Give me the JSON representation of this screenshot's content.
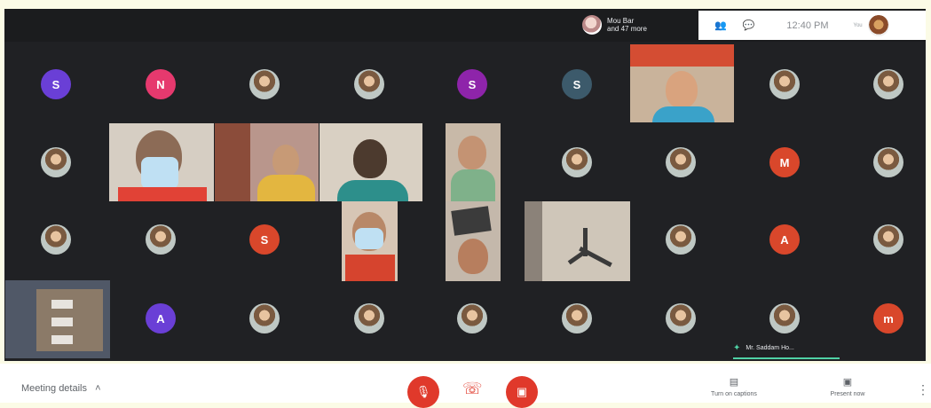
{
  "header": {
    "presenter_text": "Mou Bar\nand 47 more",
    "time": "12:40 PM",
    "self_label": "You",
    "icons": [
      "participants-icon",
      "chat-icon"
    ]
  },
  "participants": [
    {
      "type": "letter",
      "letter": "S",
      "color": "#6a3fd6"
    },
    {
      "type": "letter",
      "letter": "N",
      "color": "#e6396e"
    },
    {
      "type": "photo"
    },
    {
      "type": "photo"
    },
    {
      "type": "letter",
      "letter": "S",
      "color": "#8e24aa"
    },
    {
      "type": "letter",
      "letter": "S",
      "color": "#3c5a6b"
    },
    {
      "type": "photo"
    },
    {
      "type": "photo"
    },
    {
      "type": "photo"
    },
    {
      "type": "photo"
    },
    {
      "type": "photo"
    },
    {
      "type": "letter",
      "letter": "M",
      "color": "#d9472b"
    },
    {
      "type": "photo"
    },
    {
      "type": "photo"
    },
    {
      "type": "photo"
    },
    {
      "type": "letter",
      "letter": "S",
      "color": "#d9472b"
    },
    {
      "type": "photo"
    },
    {
      "type": "letter",
      "letter": "A",
      "color": "#d9472b"
    },
    {
      "type": "photo"
    },
    {
      "type": "letter",
      "letter": "A",
      "color": "#6a3fd6"
    },
    {
      "type": "photo"
    },
    {
      "type": "photo"
    },
    {
      "type": "photo"
    },
    {
      "type": "photo"
    },
    {
      "type": "photo"
    },
    {
      "type": "photo"
    },
    {
      "type": "letter",
      "letter": "m",
      "color": "#d9472b"
    }
  ],
  "active_speaker": "Mr. Saddam Ho...",
  "footer": {
    "meeting_details": "Meeting details",
    "captions": "Turn on captions",
    "present": "Present now"
  }
}
